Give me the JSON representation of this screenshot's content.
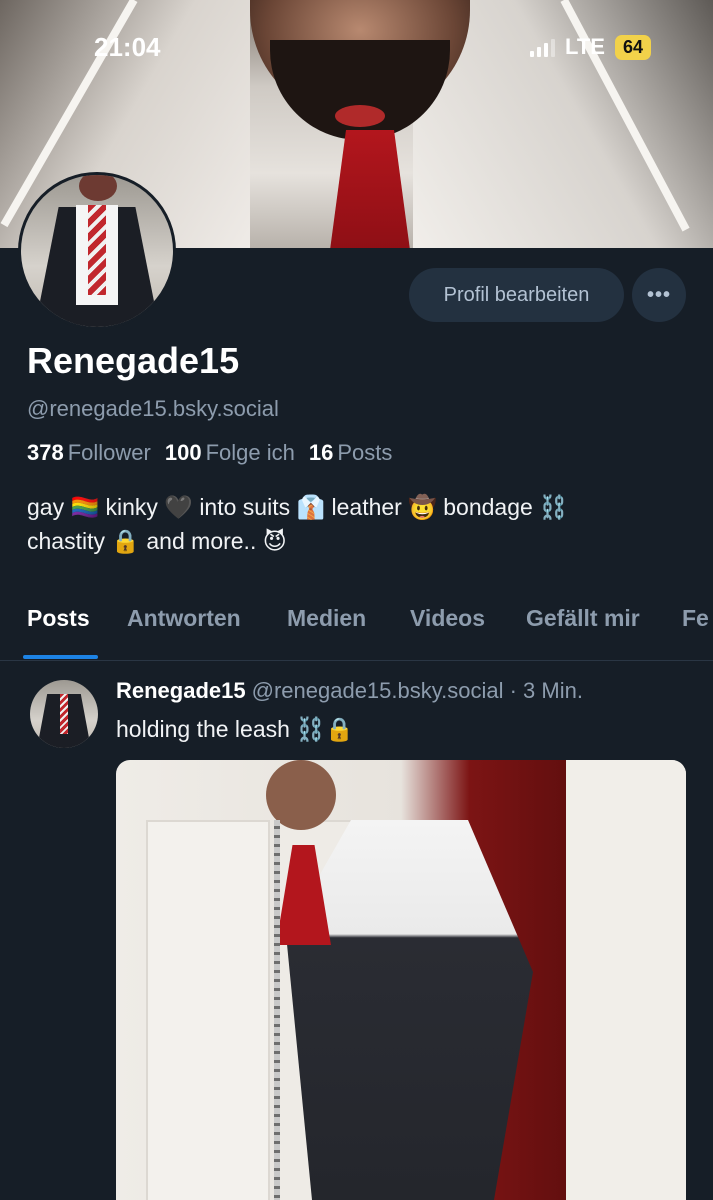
{
  "status_bar": {
    "time": "21:04",
    "network": "LTE",
    "battery": "64"
  },
  "profile": {
    "edit_label": "Profil bearbeiten",
    "more_label": "•••",
    "display_name": "Renegade15",
    "handle": "@renegade15.bsky.social",
    "stats": {
      "followers_count": "378",
      "followers_label": "Follower",
      "following_count": "100",
      "following_label": "Folge ich",
      "posts_count": "16",
      "posts_label": "Posts"
    },
    "bio": "gay 🏳️‍🌈 kinky 🖤 into suits 👔 leather 🤠 bondage ⛓️\nchastity 🔒 and more.. 😈"
  },
  "tabs": [
    "Posts",
    "Antworten",
    "Medien",
    "Videos",
    "Gefällt mir",
    "Fe"
  ],
  "post": {
    "author": "Renegade15",
    "handle": "@renegade15.bsky.social",
    "time": "· 3 Min.",
    "text": "holding the leash ⛓️🔒"
  },
  "colors": {
    "background": "#161e27",
    "accent": "#1d83e4",
    "muted_text": "#8d9cad",
    "button_bg": "#233140"
  }
}
